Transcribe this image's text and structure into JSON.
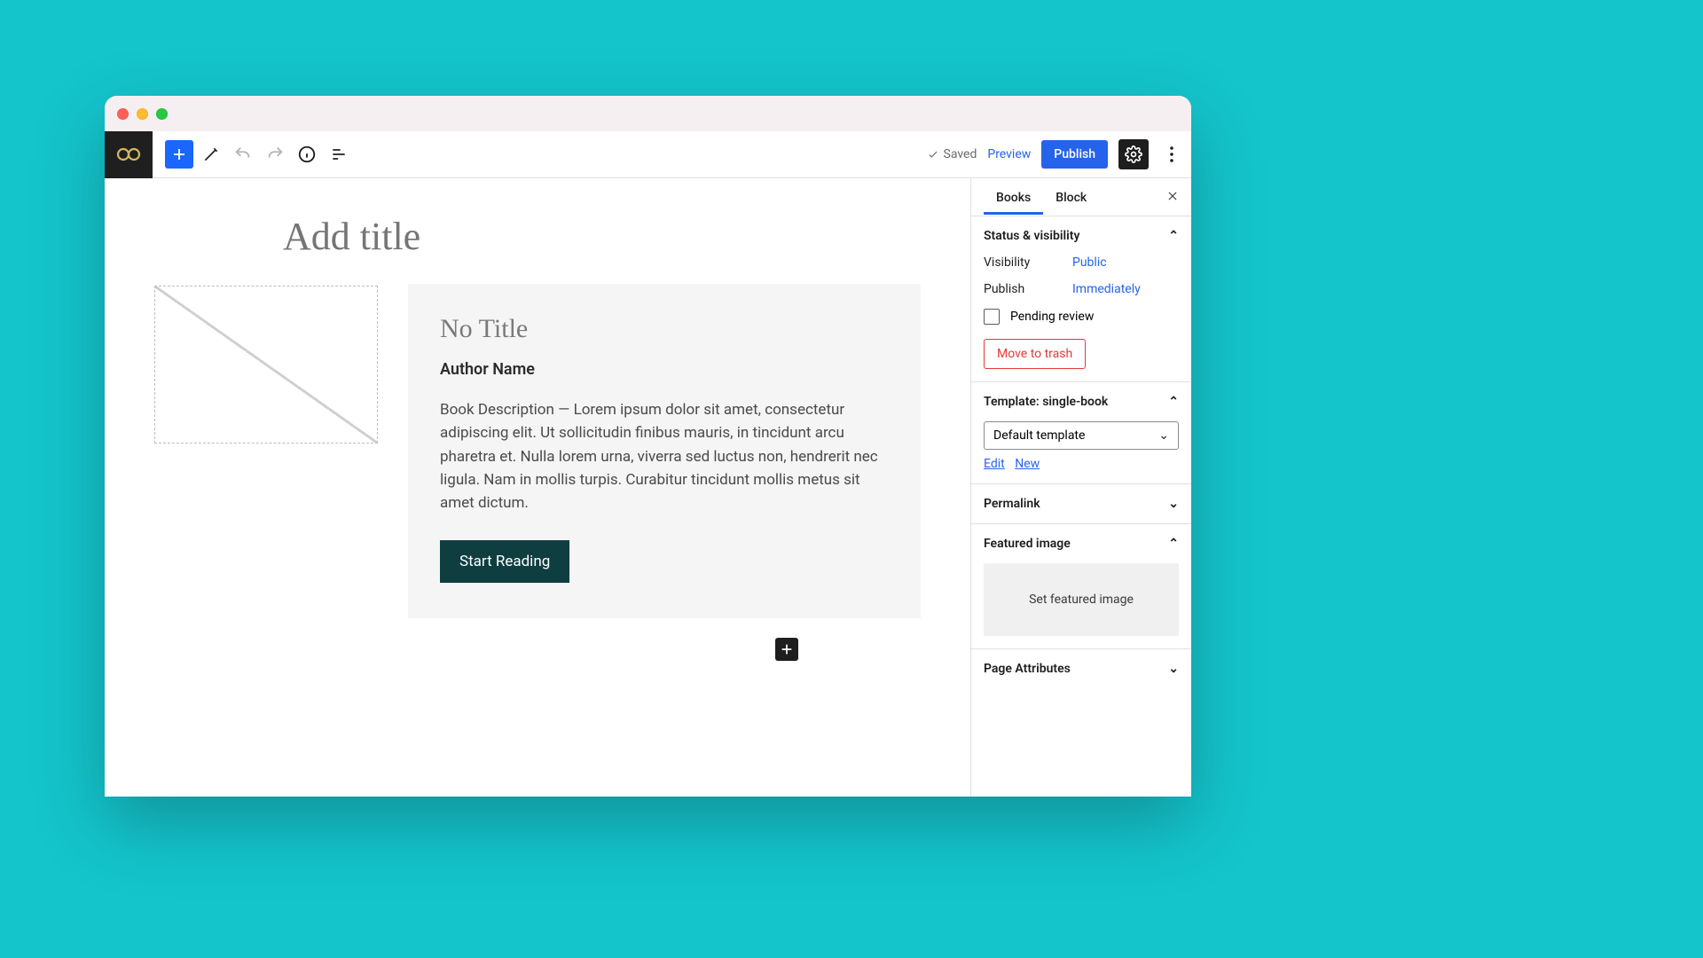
{
  "topbar": {
    "saved": "Saved",
    "preview": "Preview",
    "publish": "Publish"
  },
  "editor": {
    "title_placeholder": "Add title",
    "card": {
      "title": "No Title",
      "author": "Author Name",
      "description": "Book Description — Lorem ipsum dolor sit amet, consectetur adipiscing elit. Ut sollicitudin finibus mauris, in tincidunt arcu pharetra et. Nulla lorem urna, viverra sed luctus non, hendrerit nec ligula. Nam in mollis turpis. Curabitur tincidunt mollis metus sit amet dictum.",
      "cta": "Start Reading"
    }
  },
  "sidebar": {
    "tabs": {
      "books": "Books",
      "block": "Block"
    },
    "status": {
      "heading": "Status & visibility",
      "visibility_label": "Visibility",
      "visibility_value": "Public",
      "publish_label": "Publish",
      "publish_value": "Immediately",
      "pending_review": "Pending review",
      "trash": "Move to trash"
    },
    "template": {
      "heading": "Template: single-book",
      "select_value": "Default template",
      "edit": "Edit",
      "new": "New"
    },
    "permalink_heading": "Permalink",
    "featured": {
      "heading": "Featured image",
      "cta": "Set featured image"
    },
    "page_attr": "Page Attributes"
  }
}
